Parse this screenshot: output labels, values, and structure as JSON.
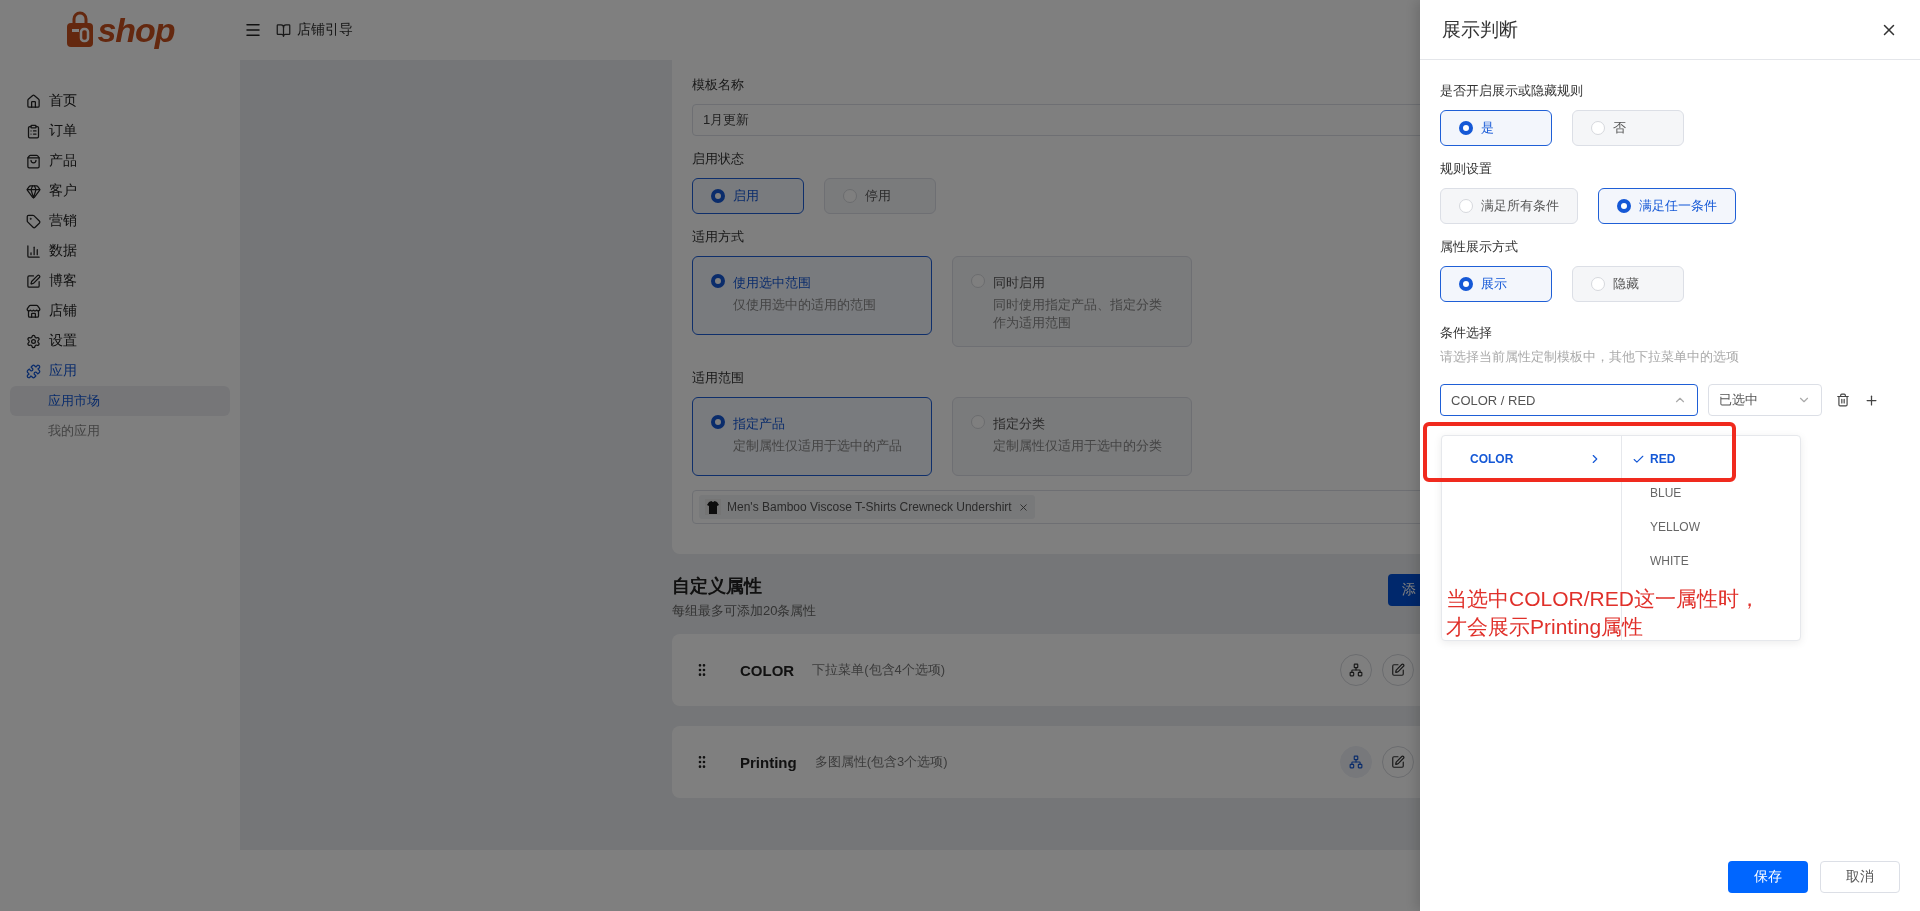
{
  "header": {
    "logo_text": "shop",
    "guide_label": "店铺引导"
  },
  "sidebar": {
    "items": [
      {
        "label": "首页"
      },
      {
        "label": "订单"
      },
      {
        "label": "产品"
      },
      {
        "label": "客户"
      },
      {
        "label": "营销"
      },
      {
        "label": "数据"
      },
      {
        "label": "博客"
      },
      {
        "label": "店铺"
      },
      {
        "label": "设置"
      },
      {
        "label": "应用",
        "expanded": true,
        "children": [
          {
            "label": "应用市场",
            "selected": true
          },
          {
            "label": "我的应用",
            "selected": false
          }
        ]
      }
    ]
  },
  "form": {
    "template_name": {
      "label": "模板名称",
      "value": "1月更新"
    },
    "status": {
      "label": "启用状态",
      "options": [
        {
          "label": "启用",
          "selected": true
        },
        {
          "label": "停用",
          "selected": false
        }
      ]
    },
    "apply_mode": {
      "label": "适用方式",
      "options": [
        {
          "title": "使用选中范围",
          "description": "仅使用选中的适用的范围",
          "selected": true
        },
        {
          "title": "同时启用",
          "description": "同时使用指定产品、指定分类作为适用范围",
          "selected": false
        }
      ]
    },
    "scope": {
      "label": "适用范围",
      "options": [
        {
          "title": "指定产品",
          "description": "定制属性仅适用于选中的产品",
          "selected": true
        },
        {
          "title": "指定分类",
          "description": "定制属性仅适用于选中的分类",
          "selected": false
        }
      ]
    },
    "product_tags": [
      {
        "name": "Men's Bamboo Viscose T-Shirts Crewneck Undershirt"
      }
    ]
  },
  "custom_attributes": {
    "title": "自定义属性",
    "subtitle": "每组最多可添加20条属性",
    "add_button": "添",
    "rows": [
      {
        "name": "COLOR",
        "description": "下拉菜单(包含4个选项)",
        "has_rule": false
      },
      {
        "name": "Printing",
        "description": "多图属性(包含3个选项)",
        "has_rule": true
      }
    ]
  },
  "drawer": {
    "title": "展示判断",
    "sections": [
      {
        "label": "是否开启展示或隐藏规则",
        "options": [
          {
            "label": "是",
            "selected": true
          },
          {
            "label": "否",
            "selected": false
          }
        ]
      },
      {
        "label": "规则设置",
        "options": [
          {
            "label": "满足所有条件",
            "selected": false
          },
          {
            "label": "满足任一条件",
            "selected": true
          }
        ]
      },
      {
        "label": "属性展示方式",
        "options": [
          {
            "label": "展示",
            "selected": true
          },
          {
            "label": "隐藏",
            "selected": false
          }
        ]
      }
    ],
    "condition": {
      "label": "条件选择",
      "hint": "请选择当前属性定制模板中，其他下拉菜单中的选项",
      "value": "COLOR / RED",
      "open": true,
      "state": "已选中",
      "groups": [
        {
          "label": "COLOR",
          "selected": true
        }
      ],
      "values": [
        {
          "label": "RED",
          "selected": true
        },
        {
          "label": "BLUE",
          "selected": false
        },
        {
          "label": "YELLOW",
          "selected": false
        },
        {
          "label": "WHITE",
          "selected": false
        }
      ]
    },
    "buttons": [
      {
        "label": "保存",
        "kind": "primary"
      },
      {
        "label": "取消",
        "kind": "default"
      }
    ]
  },
  "annotation": {
    "lines": [
      "当选中COLOR/RED这一属性时，",
      "才会展示Printing属性"
    ]
  }
}
